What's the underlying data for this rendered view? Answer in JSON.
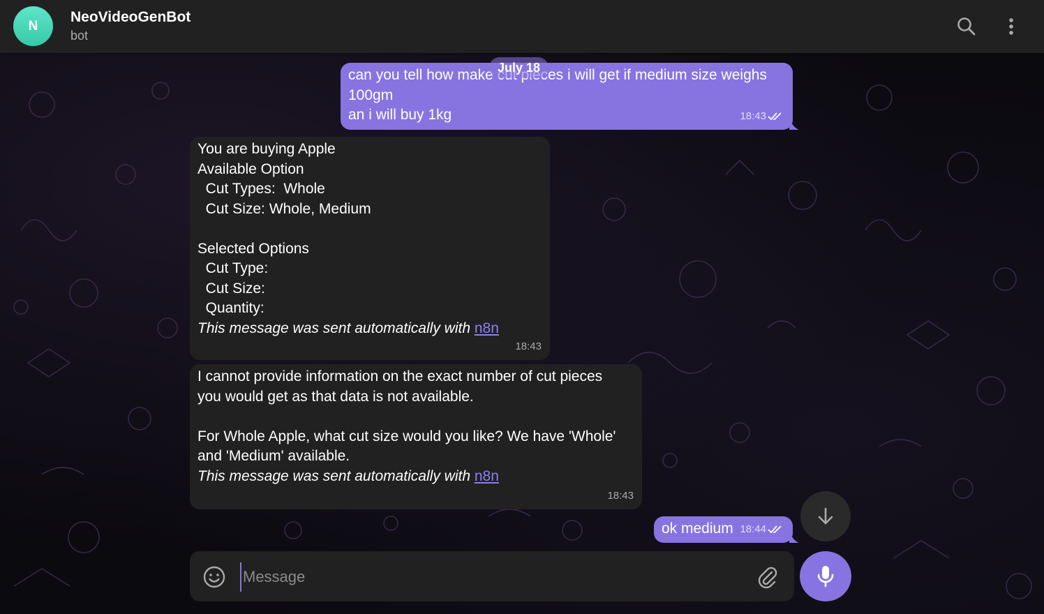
{
  "header": {
    "avatar_letter": "N",
    "title": "NeoVideoGenBot",
    "subtitle": "bot",
    "icons": [
      "search-icon",
      "more-vertical-icon"
    ]
  },
  "date_pill": "July 18",
  "messages": [
    {
      "direction": "outgoing",
      "text": "can you tell how make cut pieces i will get if medium size weighs\n100gm\nan i will buy 1kg",
      "time": "18:43",
      "status": "read"
    },
    {
      "direction": "incoming",
      "text": "You are buying Apple\nAvailable Option\n  Cut Types:  Whole\n  Cut Size: Whole, Medium\n\nSelected Options\n  Cut Type:\n  Cut Size:\n  Quantity:\n",
      "auto_text": "This message was sent automatically with",
      "link": "n8n",
      "time": "18:43"
    },
    {
      "direction": "incoming",
      "text": "I cannot provide information on the exact number of cut pieces\nyou would get as that data is not available.\n\nFor Whole Apple, what cut size would you like? We have 'Whole'\nand 'Medium' available.\n",
      "auto_text": "This message was sent automatically with",
      "link": "n8n",
      "time": "18:43"
    },
    {
      "direction": "outgoing",
      "text": "ok medium",
      "time": "18:44",
      "status": "read"
    }
  ],
  "composer": {
    "placeholder": "Message",
    "icons": [
      "emoji-icon",
      "attach-icon",
      "microphone-icon"
    ]
  },
  "colors": {
    "accent": "#8774e1",
    "header_bg": "#212121",
    "incoming_bg": "#212121",
    "avatar": "#4fd9bb"
  }
}
